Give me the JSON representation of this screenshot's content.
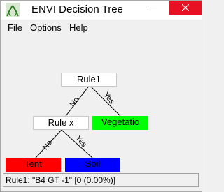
{
  "window": {
    "title": "ENVI Decision Tree",
    "icon": "decision-tree-app-icon",
    "close_icon": "close-icon",
    "minimize_icon": "minimize-icon"
  },
  "menu": {
    "items": [
      {
        "label": "File"
      },
      {
        "label": "Options"
      },
      {
        "label": "Help"
      }
    ]
  },
  "tree": {
    "root": {
      "label": "Rule1"
    },
    "rule_x": {
      "label": "Rule x"
    },
    "vegetation": {
      "label": "Vegetatio",
      "color": "#00ff00"
    },
    "tent": {
      "label": "Tent",
      "color": "#ff0000"
    },
    "soil": {
      "label": "Soil",
      "color": "#0000ff"
    },
    "edges": {
      "root_no": "No",
      "root_yes": "Yes",
      "rulex_no": "No",
      "rulex_yes": "Yes"
    }
  },
  "status": {
    "text": "Rule1: \"B4 GT -1\" [0 (0.00%)]"
  }
}
